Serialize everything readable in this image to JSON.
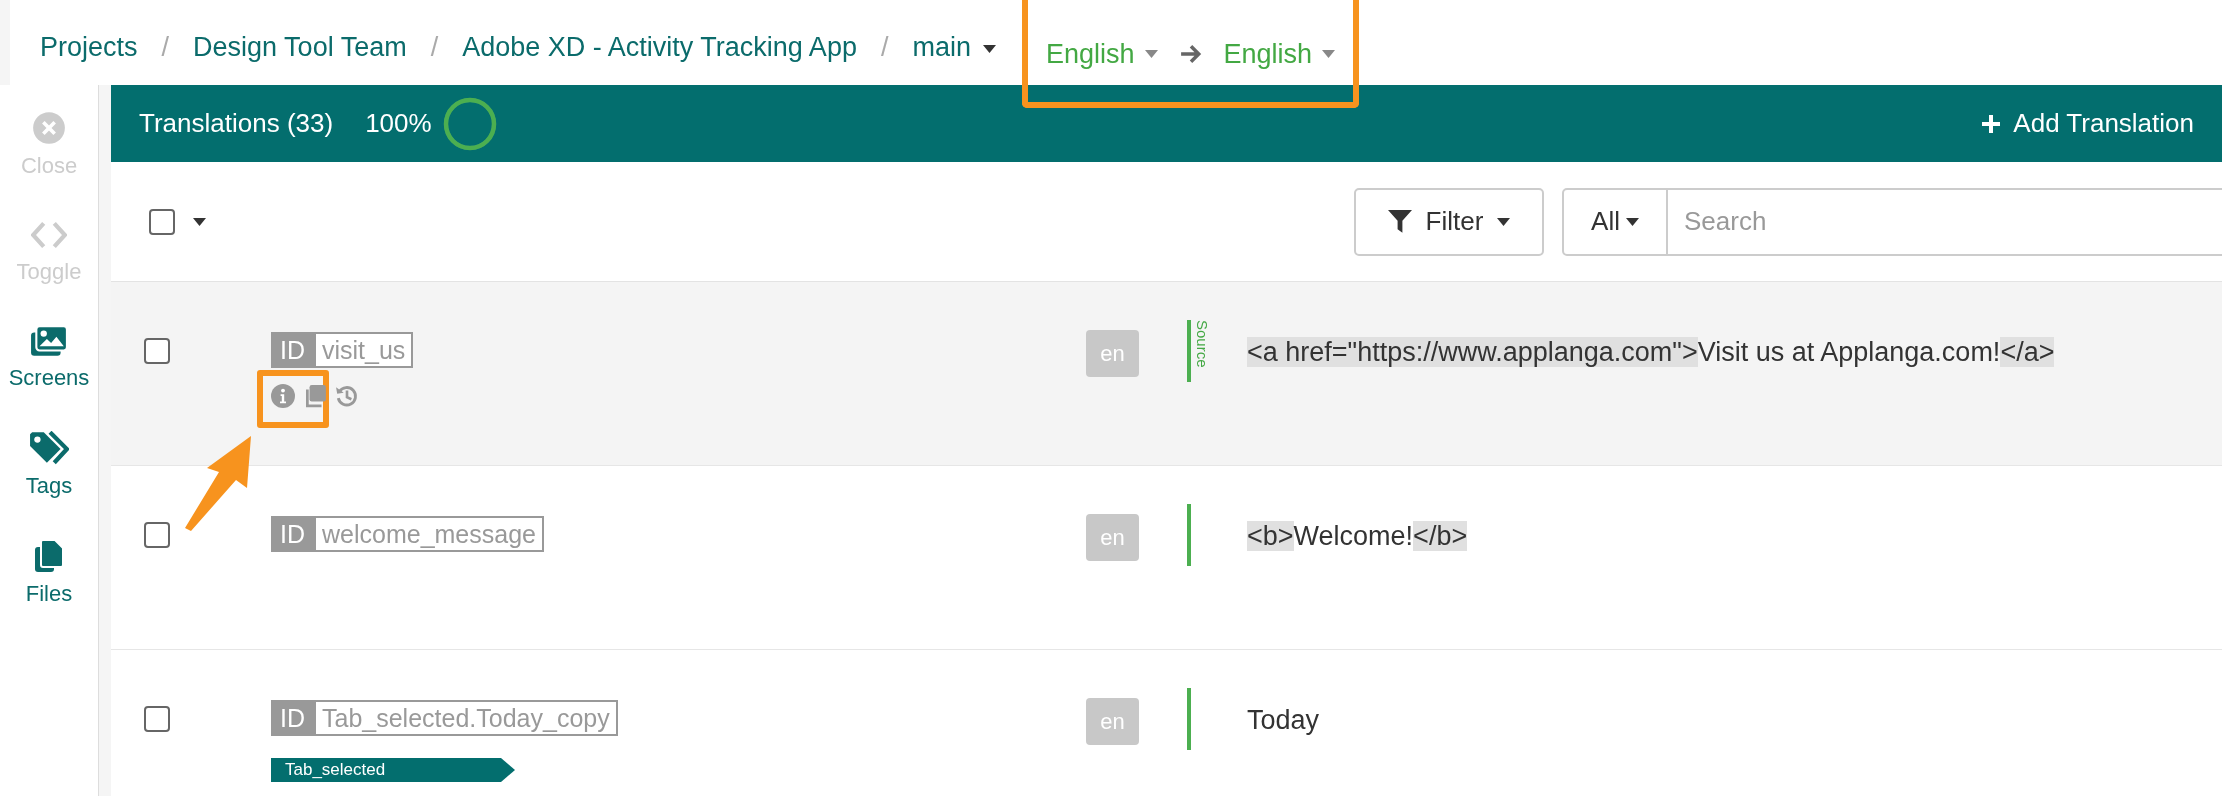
{
  "breadcrumb": [
    {
      "kind": "link",
      "label": "Projects"
    },
    {
      "kind": "separator",
      "label": "/"
    },
    {
      "kind": "link",
      "label": "Design Tool Team"
    },
    {
      "kind": "separator",
      "label": "/"
    },
    {
      "kind": "link",
      "label": "Adobe XD - Activity Tracking App"
    },
    {
      "kind": "separator",
      "label": "/"
    },
    {
      "kind": "dropdown",
      "label": "main"
    }
  ],
  "language_pair": {
    "source": "English",
    "target": "English",
    "highlighted": true
  },
  "sidebar": [
    {
      "kind": "close",
      "label": "Close",
      "disabled": true
    },
    {
      "kind": "toggle",
      "label": "Toggle",
      "disabled": true
    },
    {
      "kind": "screens",
      "label": "Screens",
      "disabled": false
    },
    {
      "kind": "tags",
      "label": "Tags",
      "disabled": false
    },
    {
      "kind": "files",
      "label": "Files",
      "disabled": false
    }
  ],
  "header": {
    "title": "Translations (33)",
    "percent": "100%",
    "level": 1,
    "add_button": "Add Translation"
  },
  "toolbar": {
    "select_all_checked": false,
    "filter": "Filter",
    "scope": "All",
    "search_placeholder": "Search"
  },
  "rows": [
    {
      "id_label": "ID",
      "key": "visit_us",
      "checked": false,
      "language": "en",
      "source_label": "Source",
      "actions": [
        {
          "kind": "info",
          "highlighted": true
        },
        {
          "kind": "copy",
          "highlighted": false
        },
        {
          "kind": "history",
          "highlighted": false
        }
      ],
      "segments": [
        {
          "kind": "tag",
          "text": "<a href=\"https://www.applanga.com\">"
        },
        {
          "kind": "text",
          "text": "Visit us at Applanga.com!"
        },
        {
          "kind": "tag",
          "text": "</a>"
        }
      ]
    },
    {
      "id_label": "ID",
      "key": "welcome_message",
      "checked": false,
      "language": "en",
      "segments": [
        {
          "kind": "tag",
          "text": "<b>"
        },
        {
          "kind": "text",
          "text": "Welcome!"
        },
        {
          "kind": "tag",
          "text": "</b>"
        }
      ]
    },
    {
      "id_label": "ID",
      "key": "Tab_selected.Today_copy",
      "checked": false,
      "language": "en",
      "tags": [
        "Tab_selected"
      ],
      "segments": [
        {
          "kind": "text",
          "text": "Today"
        }
      ]
    }
  ]
}
